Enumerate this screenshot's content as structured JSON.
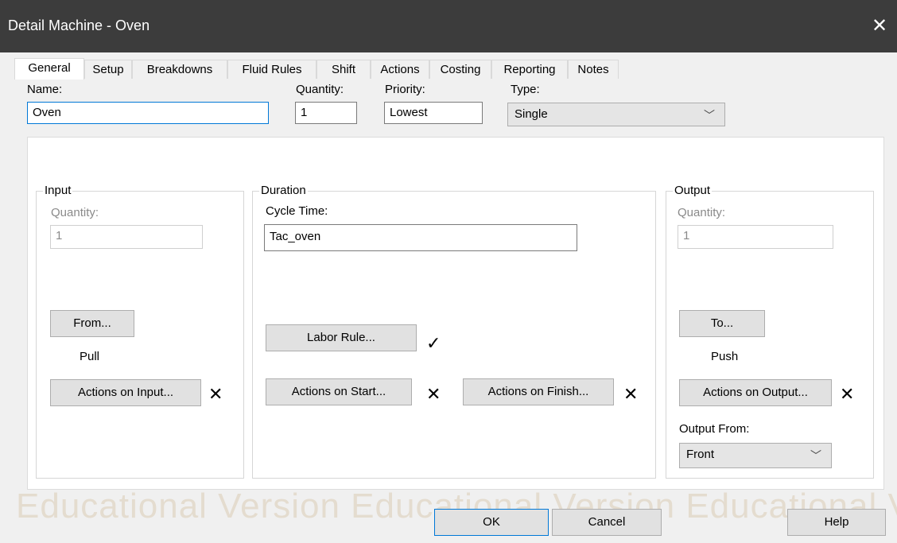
{
  "window": {
    "title": "Detail Machine - Oven",
    "close_glyph": "✕"
  },
  "tabs": [
    "General",
    "Setup",
    "Breakdowns",
    "Fluid Rules",
    "Shift",
    "Actions",
    "Costing",
    "Reporting",
    "Notes"
  ],
  "top": {
    "name_label": "Name:",
    "name_value": "Oven",
    "quantity_label": "Quantity:",
    "quantity_value": "1",
    "priority_label": "Priority:",
    "priority_value": "Lowest",
    "type_label": "Type:",
    "type_value": "Single"
  },
  "input": {
    "legend": "Input",
    "quantity_label": "Quantity:",
    "quantity_value": "1",
    "from_button": "From...",
    "mode": "Pull",
    "actions_button": "Actions on Input...",
    "actions_mark": "✕"
  },
  "duration": {
    "legend": "Duration",
    "cycle_label": "Cycle Time:",
    "cycle_value": "Tac_oven",
    "labor_button": "Labor Rule...",
    "labor_mark": "✓",
    "start_button": "Actions on Start...",
    "start_mark": "✕",
    "finish_button": "Actions on Finish...",
    "finish_mark": "✕"
  },
  "output": {
    "legend": "Output",
    "quantity_label": "Quantity:",
    "quantity_value": "1",
    "to_button": "To...",
    "mode": "Push",
    "actions_button": "Actions on Output...",
    "actions_mark": "✕",
    "from_label": "Output From:",
    "from_value": "Front"
  },
  "footer": {
    "watermark": "Educational Version  Educational Version  Educational Ve",
    "ok": "OK",
    "cancel": "Cancel",
    "help": "Help"
  }
}
